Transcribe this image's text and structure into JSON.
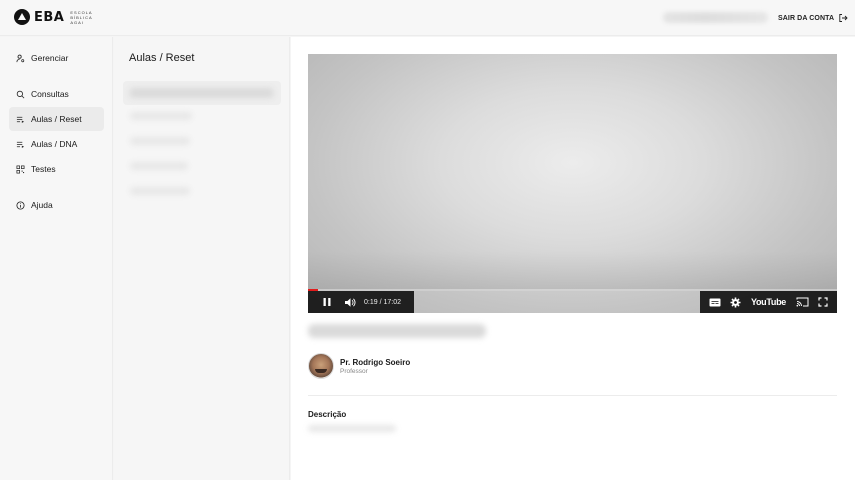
{
  "app": {
    "brand": "EBA",
    "brand_subtitle": [
      "ESCOLA",
      "BÍBLICA",
      "AGAI"
    ]
  },
  "header": {
    "logout_label": "SAIR DA CONTA",
    "logout_icon": "logout-icon"
  },
  "sidebar": {
    "items": [
      {
        "label": "Gerenciar",
        "icon": "user-settings-icon",
        "active": false
      },
      {
        "label": "Consultas",
        "icon": "search-icon",
        "active": false
      },
      {
        "label": "Aulas / Reset",
        "icon": "playlist-icon",
        "active": true
      },
      {
        "label": "Aulas / DNA",
        "icon": "playlist-icon",
        "active": false
      },
      {
        "label": "Testes",
        "icon": "qr-grid-icon",
        "active": false
      },
      {
        "label": "Ajuda",
        "icon": "info-icon",
        "active": false
      }
    ]
  },
  "lessons": {
    "title": "Aulas / Reset"
  },
  "player": {
    "time": "0:19 / 17:02",
    "progress_fraction": 0.019,
    "brand": "YouTube"
  },
  "lesson": {
    "professor_name": "Pr. Rodrigo Soeiro",
    "professor_role": "Professor",
    "description_title": "Descrição"
  },
  "colors": {
    "accent": "#111111",
    "progress": "#e21b1b",
    "active_nav": "#ebebeb"
  }
}
